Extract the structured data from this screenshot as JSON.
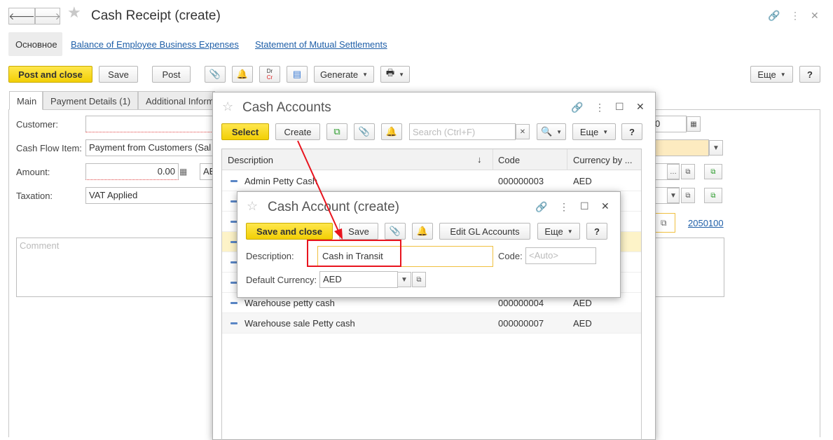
{
  "main": {
    "title": "Cash Receipt (create)",
    "nav_tabs": [
      "Основное",
      "Balance of Employee Business Expenses",
      "Statement of Mutual Settlements"
    ],
    "toolbar": {
      "post_and_close": "Post and close",
      "save": "Save",
      "post": "Post",
      "generate": "Generate",
      "more": "Еще",
      "help": "?"
    },
    "form_tabs": [
      "Main",
      "Payment Details (1)",
      "Additional Inform"
    ],
    "fields": {
      "customer_label": "Customer:",
      "customer_value": "",
      "cash_flow_label": "Cash Flow Item:",
      "cash_flow_value": "Payment from Customers (Sal",
      "amount_label": "Amount:",
      "amount_value": "0.00",
      "amount_currency": "AE",
      "taxation_label": "Taxation:",
      "taxation_value": "VAT Applied",
      "comment_placeholder": "Comment",
      "date_fragment": "0",
      "account_link": "2050100"
    }
  },
  "cash_accounts": {
    "title": "Cash Accounts",
    "toolbar": {
      "select": "Select",
      "create": "Create",
      "search_placeholder": "Search (Ctrl+F)",
      "more": "Еще",
      "help": "?"
    },
    "columns": [
      "Description",
      "Code",
      "Currency by ..."
    ],
    "rows": [
      {
        "description": "Admin Petty Cash",
        "code": "000000003",
        "currency": "AED"
      },
      {
        "description": "Warehouse petty cash",
        "code": "000000004",
        "currency": "AED"
      },
      {
        "description": "Warehouse sale Petty cash",
        "code": "000000007",
        "currency": "AED"
      }
    ]
  },
  "cash_account_create": {
    "title": "Cash Account (create)",
    "toolbar": {
      "save_and_close": "Save and close",
      "save": "Save",
      "edit_gl": "Edit GL Accounts",
      "more": "Еще",
      "help": "?"
    },
    "description_label": "Description:",
    "description_value": "Cash in Transit",
    "code_label": "Code:",
    "code_placeholder": "<Auto>",
    "currency_label": "Default Currency:",
    "currency_value": "AED"
  },
  "colors": {
    "accent_yellow": "#f2cf05",
    "highlight_red": "#e8141e",
    "link_blue": "#1f5fa8",
    "focus_orange": "#f0c040"
  }
}
